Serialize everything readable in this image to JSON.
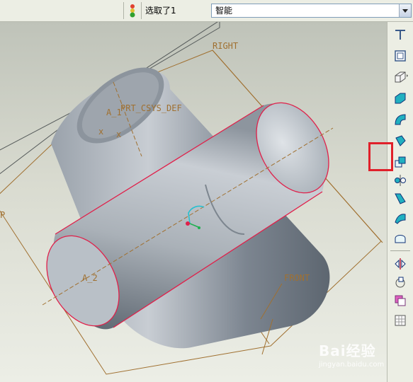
{
  "statusbar": {
    "selected_text": "选取了1",
    "filter_value": "智能"
  },
  "viewport": {
    "datum_labels": {
      "right": "RIGHT",
      "csys": "PRT_CSYS_DEF",
      "axis1": "A_1",
      "axis2": "A_2",
      "front": "FRONT",
      "top": "P"
    }
  },
  "toolbar": {
    "tools": [
      "datum-curve-sketch-icon",
      "datum-plane-icon",
      "extrude-icon",
      "revolve-icon",
      "sweep-icon",
      "blend-icon",
      "offset-icon",
      "pattern-icon",
      "draft-icon",
      "boundary-blend-icon",
      "fill-icon",
      "mirror-icon",
      "rotate-copy-icon",
      "merge-icon",
      "grid-icon"
    ],
    "highlighted_tool": "offset-icon"
  },
  "watermark": {
    "brand": "Bai经验",
    "url": "jingyan.baidu.com"
  },
  "colors": {
    "datum": "#a07030",
    "selection_edge": "#e0204a",
    "highlight_box": "#e0202a"
  }
}
